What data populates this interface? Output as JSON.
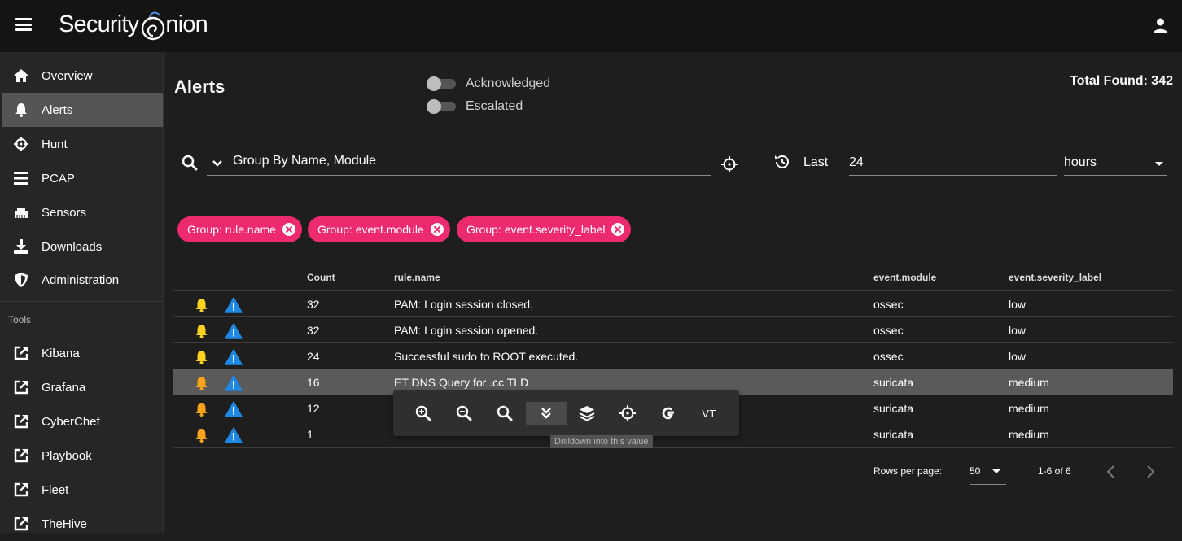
{
  "app": {
    "logo_text": "Security",
    "logo_text2": "nion"
  },
  "sidebar": {
    "items": [
      {
        "label": "Overview",
        "icon": "home-icon"
      },
      {
        "label": "Alerts",
        "icon": "bell-icon"
      },
      {
        "label": "Hunt",
        "icon": "crosshairs-icon"
      },
      {
        "label": "PCAP",
        "icon": "list-icon"
      },
      {
        "label": "Sensors",
        "icon": "ethernet-icon"
      },
      {
        "label": "Downloads",
        "icon": "download-icon"
      },
      {
        "label": "Administration",
        "icon": "shield-icon"
      }
    ],
    "tools_header": "Tools",
    "tools": [
      {
        "label": "Kibana",
        "icon": "external-link-icon"
      },
      {
        "label": "Grafana",
        "icon": "external-link-icon"
      },
      {
        "label": "CyberChef",
        "icon": "external-link-icon"
      },
      {
        "label": "Playbook",
        "icon": "external-link-icon"
      },
      {
        "label": "Fleet",
        "icon": "external-link-icon"
      },
      {
        "label": "TheHive",
        "icon": "external-link-icon"
      }
    ]
  },
  "header": {
    "title": "Alerts",
    "toggles": [
      {
        "label": "Acknowledged",
        "on": false
      },
      {
        "label": "Escalated",
        "on": false
      }
    ],
    "total_found": "Total Found: 342"
  },
  "search": {
    "query": "Group By Name, Module",
    "last_label": "Last",
    "range_value": "24",
    "range_unit": "hours"
  },
  "chips": [
    {
      "label": "Group: rule.name"
    },
    {
      "label": "Group: event.module"
    },
    {
      "label": "Group: event.severity_label"
    }
  ],
  "table": {
    "columns": [
      "Count",
      "rule.name",
      "event.module",
      "event.severity_label"
    ],
    "rows": [
      {
        "count": "32",
        "rule": "PAM: Login session closed.",
        "module": "ossec",
        "severity": "low"
      },
      {
        "count": "32",
        "rule": "PAM: Login session opened.",
        "module": "ossec",
        "severity": "low"
      },
      {
        "count": "24",
        "rule": "Successful sudo to ROOT executed.",
        "module": "ossec",
        "severity": "low"
      },
      {
        "count": "16",
        "rule": "ET DNS Query for .cc TLD",
        "module": "suricata",
        "severity": "medium"
      },
      {
        "count": "12",
        "rule": "",
        "module": "suricata",
        "severity": "medium"
      },
      {
        "count": "1",
        "rule": "",
        "module": "suricata",
        "severity": "medium"
      }
    ],
    "highlighted_row": 3
  },
  "popup": {
    "buttons": [
      {
        "icon": "zoom-in-icon"
      },
      {
        "icon": "zoom-out-icon"
      },
      {
        "icon": "search-icon"
      },
      {
        "icon": "drilldown-icon"
      },
      {
        "icon": "layers-icon"
      },
      {
        "icon": "crosshairs-icon"
      },
      {
        "icon": "google-icon"
      },
      {
        "icon": "vt-icon",
        "label": "VT"
      }
    ],
    "tooltip": "Drilldown into this value"
  },
  "footer": {
    "rows_per_page_label": "Rows per page:",
    "rows_per_page": "50",
    "page_info": "1-6 of 6"
  },
  "colors": {
    "accent_chip": "#ee2a6e",
    "bell_low": "#ffd21f",
    "bell_medium": "#ffa31a",
    "warn_blue": "#1e88e5",
    "sidebar_active": "#555555"
  }
}
